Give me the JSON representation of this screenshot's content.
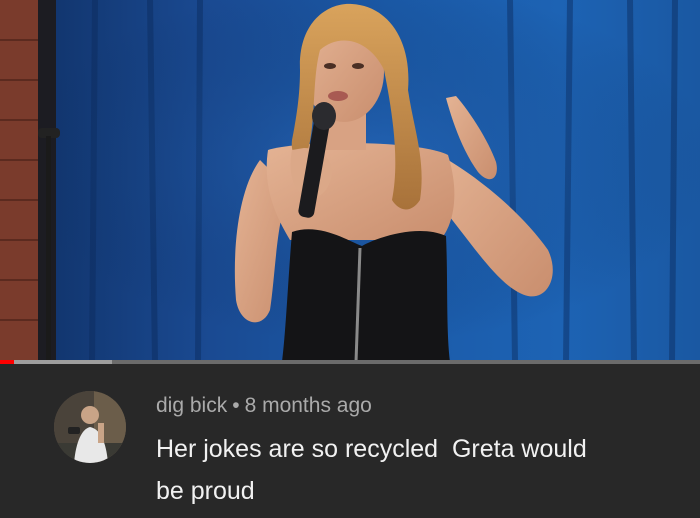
{
  "video": {
    "progress_percent": 2,
    "buffered_percent": 16,
    "progress_color": "#ff0000"
  },
  "comment": {
    "author": "dig bick",
    "separator": "•",
    "timestamp": "8 months ago",
    "text": "Her jokes are so recycled  Greta would\nbe proud"
  }
}
